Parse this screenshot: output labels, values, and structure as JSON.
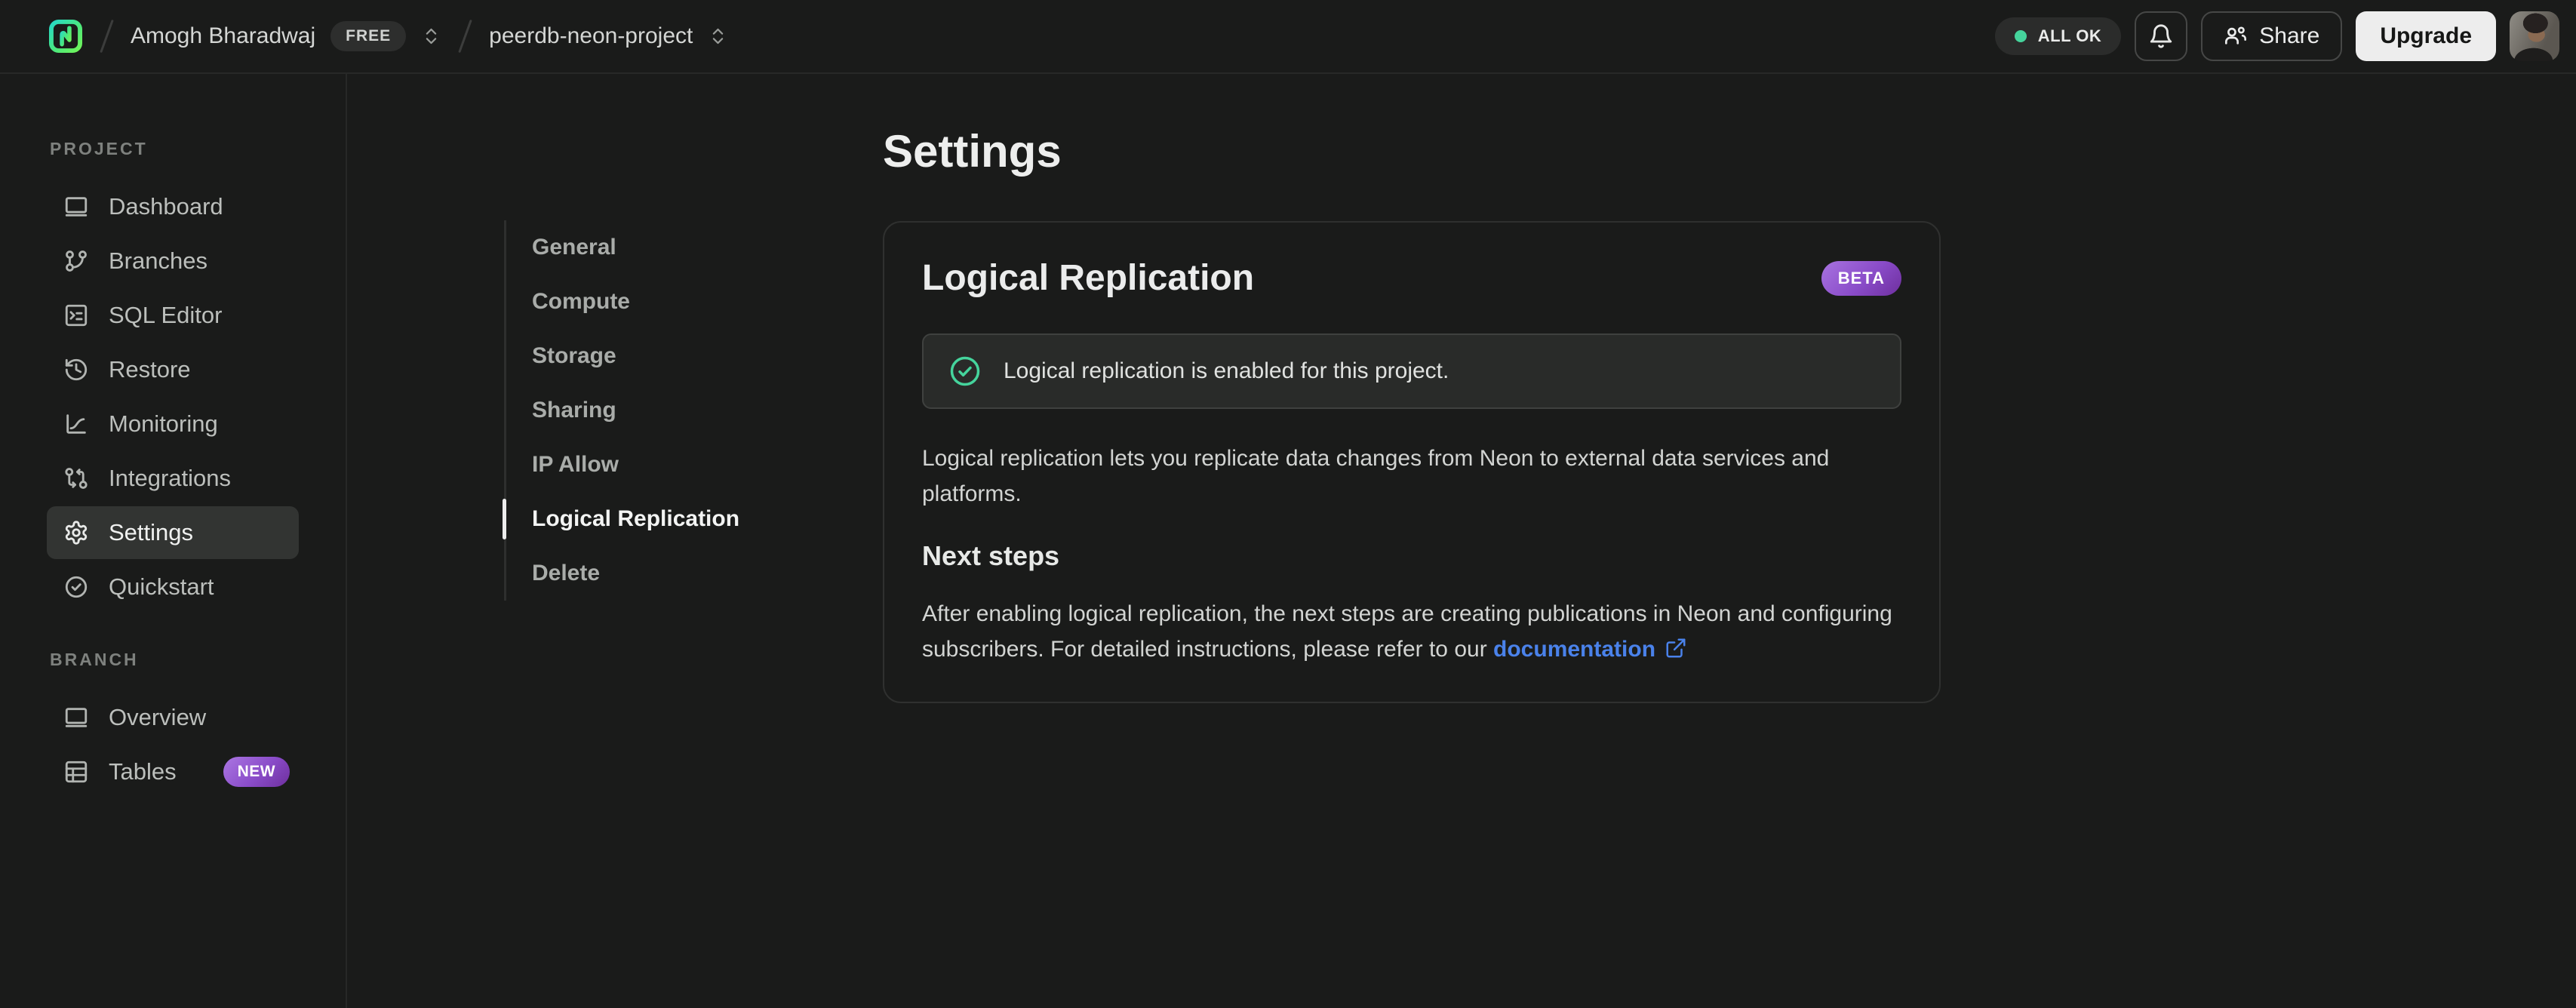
{
  "topbar": {
    "logo_name": "Neon",
    "breadcrumb": {
      "org_name": "Amogh Bharadwaj",
      "org_badge": "FREE",
      "project_name": "peerdb-neon-project"
    },
    "status_pill": "ALL OK",
    "share_label": "Share",
    "upgrade_label": "Upgrade"
  },
  "sidebar": {
    "sections": [
      {
        "label": "PROJECT",
        "items": [
          {
            "label": "Dashboard"
          },
          {
            "label": "Branches"
          },
          {
            "label": "SQL Editor"
          },
          {
            "label": "Restore"
          },
          {
            "label": "Monitoring"
          },
          {
            "label": "Integrations"
          },
          {
            "label": "Settings",
            "active": true
          },
          {
            "label": "Quickstart"
          }
        ]
      },
      {
        "label": "BRANCH",
        "items": [
          {
            "label": "Overview"
          },
          {
            "label": "Tables",
            "badge": "NEW"
          }
        ]
      }
    ]
  },
  "settings_nav": {
    "items": [
      {
        "label": "General"
      },
      {
        "label": "Compute"
      },
      {
        "label": "Storage"
      },
      {
        "label": "Sharing"
      },
      {
        "label": "IP Allow"
      },
      {
        "label": "Logical Replication",
        "active": true
      },
      {
        "label": "Delete"
      }
    ]
  },
  "main": {
    "page_title": "Settings",
    "card": {
      "title": "Logical Replication",
      "badge": "BETA",
      "banner_text": "Logical replication is enabled for this project.",
      "description_line1": "Logical replication lets you replicate data changes from Neon to external data services and",
      "description_line2": "platforms.",
      "next_steps_title": "Next steps",
      "next_steps_line1": "After enabling logical replication, the next steps are creating publications in Neon and configuring",
      "next_steps_line2_prefix": "subscribers. For detailed instructions, please refer to our ",
      "next_steps_link": "documentation"
    }
  },
  "colors": {
    "background": "#1a1b1a",
    "divider": "#272827",
    "card_border": "#2f302f",
    "banner_bg": "#292b29",
    "success_green": "#45d49c",
    "link_blue": "#4a82ea",
    "badge_purple_from": "#a873e0",
    "badge_purple_to": "#6e2f9e",
    "upgrade_bg": "#ededed",
    "brand_teal": "#26d9c7",
    "brand_green": "#71f559"
  }
}
